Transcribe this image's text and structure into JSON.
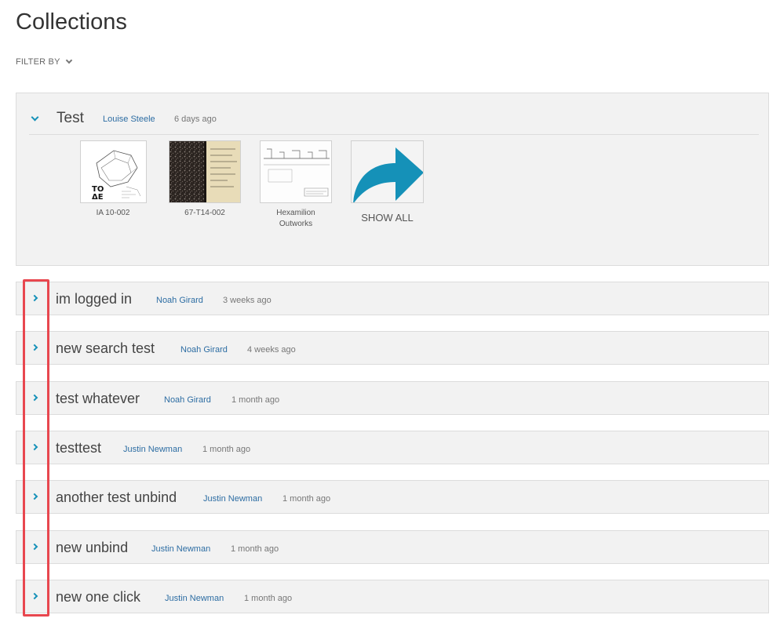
{
  "page": {
    "title": "Collections"
  },
  "filter": {
    "label": "FILTER BY",
    "icon": "chevron-down-icon"
  },
  "expanded_collection": {
    "name": "Test",
    "owner": "Louise Steele",
    "time": "6 days ago",
    "thumbnails": [
      {
        "label": "IA 10-002"
      },
      {
        "label": "67-T14-002"
      },
      {
        "label_line1": "Hexamilion",
        "label_line2": "Outworks"
      }
    ],
    "show_all": {
      "label": "SHOW ALL",
      "icon": "arrow-right-icon"
    }
  },
  "collections": [
    {
      "name": "im logged in",
      "owner": "Noah Girard",
      "time": "3 weeks ago"
    },
    {
      "name": "new search test",
      "owner": "Noah Girard",
      "time": "4 weeks ago"
    },
    {
      "name": "test whatever",
      "owner": "Noah Girard",
      "time": "1 month ago"
    },
    {
      "name": "testtest",
      "owner": "Justin Newman",
      "time": "1 month ago"
    },
    {
      "name": "another test unbind",
      "owner": "Justin Newman",
      "time": "1 month ago"
    },
    {
      "name": "new unbind",
      "owner": "Justin Newman",
      "time": "1 month ago"
    },
    {
      "name": "new one click",
      "owner": "Justin Newman",
      "time": "1 month ago"
    }
  ],
  "colors": {
    "accent": "#1591b8",
    "link": "#2d6da3",
    "highlight": "#e8474f",
    "panel": "#f2f2f2"
  }
}
